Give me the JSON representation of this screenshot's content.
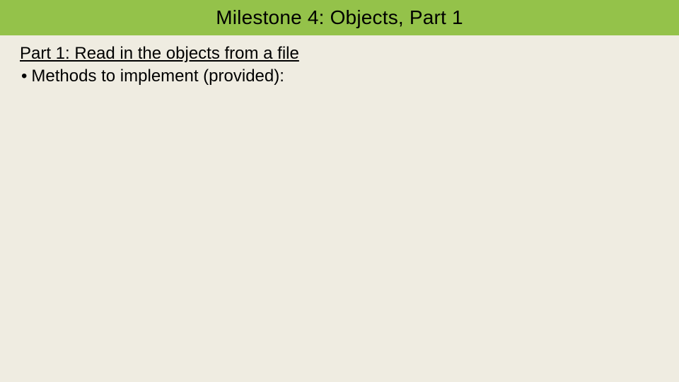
{
  "header": {
    "title": "Milestone 4: Objects, Part 1"
  },
  "content": {
    "subheading": "Part 1: Read in the objects from a file",
    "bullet1": "Methods to implement (provided):"
  }
}
